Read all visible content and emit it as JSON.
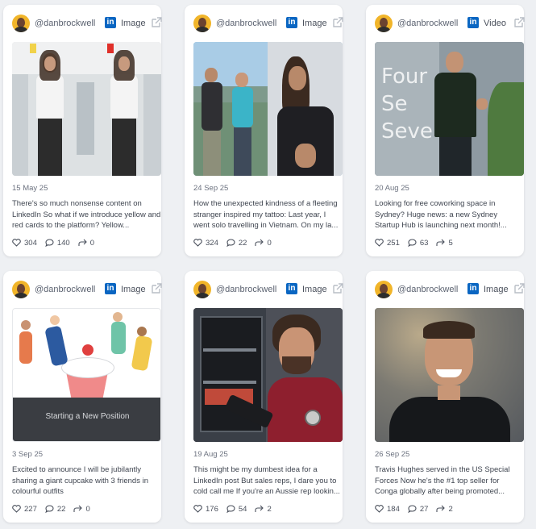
{
  "colors": {
    "linkedin": "#0a66c2",
    "background": "#eef0f3",
    "card": "#ffffff"
  },
  "cards": [
    {
      "handle": "@danbrockwell",
      "platform_icon": "linkedin-icon",
      "platform_letters": "in",
      "type": "Image",
      "date": "15 May 25",
      "description": "There's so much nonsense content on LinkedIn So what if we introduce yellow and red cards to the platform? Yellow...",
      "likes": "304",
      "comments": "140",
      "shares": "0"
    },
    {
      "handle": "@danbrockwell",
      "platform_icon": "linkedin-icon",
      "platform_letters": "in",
      "type": "Image",
      "date": "24 Sep 25",
      "description": "How the unexpected kindness of a fleeting stranger inspired my tattoo: Last year, I went solo travelling in Vietnam. On my la...",
      "likes": "324",
      "comments": "22",
      "shares": "0"
    },
    {
      "handle": "@danbrockwell",
      "platform_icon": "linkedin-icon",
      "platform_letters": "in",
      "type": "Video",
      "date": "20 Aug 25",
      "description": "Looking for free coworking space in Sydney? Huge news: a new Sydney Startup Hub is launching next month!...",
      "likes": "251",
      "comments": "63",
      "shares": "5",
      "thumb_sign": [
        "Four",
        "Se",
        "Seve"
      ]
    },
    {
      "handle": "@danbrockwell",
      "platform_icon": "linkedin-icon",
      "platform_letters": "in",
      "type": "Image",
      "date": "3 Sep 25",
      "description": "Excited to announce I will be jubilantly sharing a giant cupcake with 3 friends in colourful outfits",
      "likes": "227",
      "comments": "22",
      "shares": "0",
      "thumb_caption": "Starting a New Position"
    },
    {
      "handle": "@danbrockwell",
      "platform_icon": "linkedin-icon",
      "platform_letters": "in",
      "type": "Image",
      "date": "19 Aug 25",
      "description": "This might be my dumbest idea for a LinkedIn post But sales reps, I dare you to cold call me If you're an Aussie rep lookin...",
      "likes": "176",
      "comments": "54",
      "shares": "2"
    },
    {
      "handle": "@danbrockwell",
      "platform_icon": "linkedin-icon",
      "platform_letters": "in",
      "type": "Image",
      "date": "26 Sep 25",
      "description": "Travis Hughes served in the US Special Forces Now he's the #1 top seller for Conga globally after being promoted...",
      "likes": "184",
      "comments": "27",
      "shares": "2"
    }
  ]
}
